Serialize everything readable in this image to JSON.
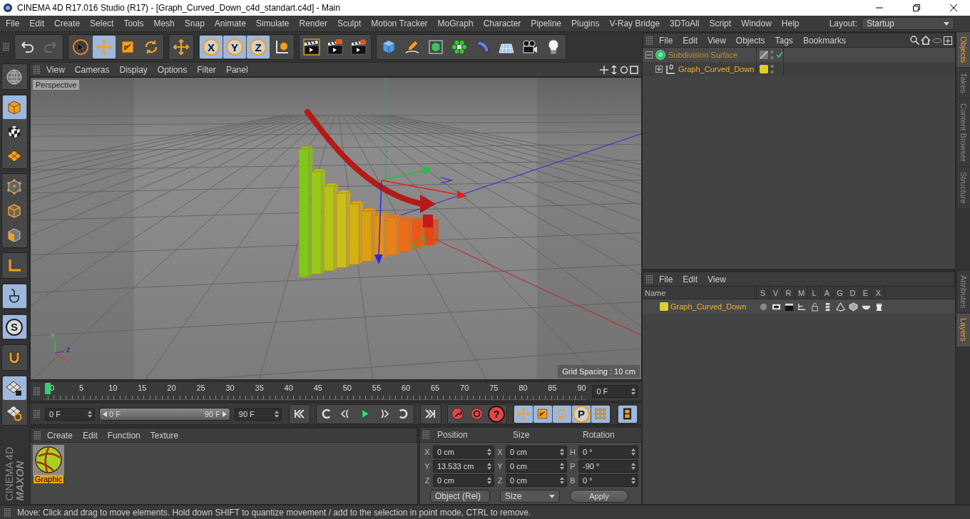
{
  "window": {
    "title": "CINEMA 4D R17.016 Studio (R17) - [Graph_Curved_Down_c4d_standart.c4d] - Main"
  },
  "menu_bar": [
    "File",
    "Edit",
    "Create",
    "Select",
    "Tools",
    "Mesh",
    "Snap",
    "Animate",
    "Simulate",
    "Render",
    "Sculpt",
    "Motion Tracker",
    "MoGraph",
    "Character",
    "Pipeline",
    "Plugins",
    "V-Ray Bridge",
    "3DToAll",
    "Script",
    "Window",
    "Help"
  ],
  "layout": {
    "label": "Layout:",
    "value": "Startup"
  },
  "toolbar": [
    {
      "tools": [
        {
          "kind": "undo",
          "selected": false,
          "disabled": false
        },
        {
          "kind": "redo",
          "selected": false,
          "disabled": true
        }
      ]
    },
    {
      "tools": [
        {
          "kind": "select",
          "selected": false,
          "disabled": false
        },
        {
          "kind": "move",
          "selected": true,
          "disabled": false
        },
        {
          "kind": "scale",
          "selected": false,
          "disabled": false
        },
        {
          "kind": "rotate",
          "selected": false,
          "disabled": false
        }
      ]
    },
    {
      "tools": [
        {
          "kind": "move",
          "selected": false,
          "disabled": false
        }
      ]
    },
    {
      "tools": [
        {
          "kind": "axis",
          "label": "X",
          "selected": true,
          "disabled": false
        },
        {
          "kind": "axis",
          "label": "Y",
          "selected": true,
          "disabled": false
        },
        {
          "kind": "axis",
          "label": "Z",
          "selected": true,
          "disabled": false
        },
        {
          "kind": "coordinates",
          "selected": false,
          "disabled": false
        }
      ]
    },
    {
      "tools": [
        {
          "kind": "render_view",
          "selected": false,
          "disabled": false
        },
        {
          "kind": "render",
          "selected": false,
          "disabled": false
        },
        {
          "kind": "render_settings",
          "selected": false,
          "disabled": false
        }
      ]
    },
    {
      "tools": [
        {
          "kind": "cube",
          "selected": false,
          "disabled": false
        },
        {
          "kind": "pen",
          "selected": false,
          "disabled": false
        },
        {
          "kind": "subdivision",
          "selected": false,
          "disabled": false
        },
        {
          "kind": "cloner",
          "selected": false,
          "disabled": false
        },
        {
          "kind": "deformer",
          "selected": false,
          "disabled": false
        },
        {
          "kind": "floor",
          "selected": false,
          "disabled": false
        },
        {
          "kind": "camera",
          "selected": false,
          "disabled": false
        },
        {
          "kind": "light",
          "selected": false,
          "disabled": false
        }
      ]
    }
  ],
  "mode_tools": [
    {
      "tools": [
        {
          "kind": "make_editable",
          "selected": false
        }
      ]
    },
    {
      "tools": [
        {
          "kind": "model",
          "selected": true
        },
        {
          "kind": "texture",
          "selected": false
        },
        {
          "kind": "workplane",
          "selected": false
        }
      ]
    },
    {
      "tools": [
        {
          "kind": "points",
          "selected": false
        },
        {
          "kind": "edges",
          "selected": false
        },
        {
          "kind": "polygons",
          "selected": false
        }
      ]
    },
    {
      "tools": [
        {
          "kind": "axis_mode",
          "selected": false
        }
      ]
    },
    {
      "tools": [
        {
          "kind": "tweak",
          "selected": true
        }
      ]
    },
    {
      "tools": [
        {
          "kind": "snap",
          "label": "S",
          "selected": true
        }
      ]
    },
    {
      "tools": [
        {
          "kind": "magnet",
          "selected": false
        }
      ]
    },
    {
      "tools": [
        {
          "kind": "workplane_lock",
          "selected": true
        },
        {
          "kind": "workplane_rotate",
          "selected": false
        }
      ]
    }
  ],
  "logo": {
    "brand": "MAXON",
    "product": "CINEMA 4D"
  },
  "viewport": {
    "menu": [
      "View",
      "Cameras",
      "Display",
      "Options",
      "Filter",
      "Panel"
    ],
    "camera_label": "Perspective",
    "axis_labels": [
      "Y",
      "Z",
      "X"
    ],
    "grid_spacing": "Grid Spacing : 10 cm"
  },
  "timeline": {
    "ticks": [
      "0",
      "5",
      "10",
      "15",
      "20",
      "25",
      "30",
      "35",
      "40",
      "45",
      "50",
      "55",
      "60",
      "65",
      "70",
      "75",
      "80",
      "85",
      "90"
    ],
    "playhead": {
      "level": 0
    },
    "current_frame": "0 F"
  },
  "transport": {
    "start": "0 F",
    "range": {
      "start": "0 F",
      "end": "90 F",
      "level": 1
    },
    "end": "90 F",
    "groups": [
      {
        "buttons": [
          {
            "kind": "go_start"
          }
        ]
      },
      {
        "buttons": [
          {
            "kind": "prev_key"
          },
          {
            "kind": "prev_frame"
          },
          {
            "kind": "play"
          },
          {
            "kind": "next_frame"
          },
          {
            "kind": "next_key"
          }
        ]
      },
      {
        "buttons": [
          {
            "kind": "go_end"
          }
        ]
      },
      {
        "buttons": [
          {
            "kind": "record"
          },
          {
            "kind": "autokey"
          },
          {
            "kind": "help",
            "label": "?"
          }
        ]
      },
      {
        "buttons": [
          {
            "kind": "move",
            "selected": true
          },
          {
            "kind": "scale",
            "selected": true
          },
          {
            "kind": "rotate",
            "selected": true
          },
          {
            "kind": "parameter",
            "label": "P",
            "selected": true
          },
          {
            "kind": "point_level",
            "selected": true
          }
        ]
      },
      {
        "buttons": [
          {
            "kind": "timeline",
            "selected": true
          }
        ]
      }
    ]
  },
  "material_manager": {
    "menu": [
      "Create",
      "Edit",
      "Function",
      "Texture"
    ],
    "materials": [
      {
        "name": "Graphic",
        "selected": true
      }
    ]
  },
  "coordinates": {
    "headers": [
      "Position",
      "Size",
      "Rotation"
    ],
    "rows": [
      {
        "position_axis": "X",
        "position": "0 cm",
        "size_axis": "X",
        "size": "0 cm",
        "rotation_axis": "H",
        "rotation": "0 °"
      },
      {
        "position_axis": "Y",
        "position": "13.533 cm",
        "size_axis": "Y",
        "size": "0 cm",
        "rotation_axis": "P",
        "rotation": "-90 °"
      },
      {
        "position_axis": "Z",
        "position": "0 cm",
        "size_axis": "Z",
        "size": "0 cm",
        "rotation_axis": "B",
        "rotation": "0 °"
      }
    ],
    "mode": "Object (Rel)",
    "size_mode": "Size",
    "apply": "Apply"
  },
  "status_bar": "Move: Click and drag to move elements. Hold down SHIFT to quantize movement / add to the selection in point mode, CTRL to remove.",
  "object_manager": {
    "menu": [
      "File",
      "Edit",
      "View",
      "Objects",
      "Tags",
      "Bookmarks"
    ],
    "objects": [
      {
        "name": "Subdivision Surface",
        "kind": "subdivision",
        "selected": false,
        "expanded": true,
        "enabled": true,
        "children": [
          {
            "name": "Graph_Curved_Down",
            "kind": "null",
            "selected": true,
            "expanded": false,
            "color": "#e0d02a"
          }
        ]
      }
    ]
  },
  "side_tabs_top": [
    {
      "label": "Objects",
      "selected": true
    },
    {
      "label": "Takes",
      "selected": false
    },
    {
      "label": "Content Browser",
      "selected": false
    },
    {
      "label": "Structure",
      "selected": false
    }
  ],
  "layer_manager": {
    "menu": [
      "File",
      "Edit",
      "View"
    ],
    "columns": [
      "Name",
      "S",
      "V",
      "R",
      "M",
      "L",
      "A",
      "G",
      "D",
      "E",
      "X"
    ],
    "layers": [
      {
        "name": "Graph_Curved_Down",
        "color": "#e0d02a"
      }
    ]
  },
  "side_tabs_bottom": [
    {
      "label": "Attributes",
      "selected": false
    },
    {
      "label": "Layers",
      "selected": true
    }
  ]
}
